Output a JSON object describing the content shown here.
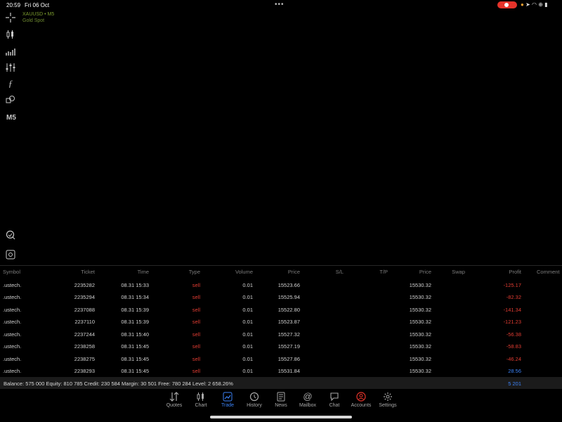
{
  "status_bar": {
    "time": "20:59",
    "date": "Fri 06 Oct"
  },
  "symbol": {
    "name": "XAUUSD",
    "timeframe": "M5",
    "description": "Gold Spot"
  },
  "toolbar": {
    "timeframe_label": "M5"
  },
  "columns": {
    "symbol": "Symbol",
    "ticket": "Ticket",
    "time": "Time",
    "type": "Type",
    "volume": "Volume",
    "price": "Price",
    "sl": "S/L",
    "tp": "T/P",
    "current_price": "Price",
    "swap": "Swap",
    "profit": "Profit",
    "comment": "Comment"
  },
  "rows": [
    {
      "symbol": ".ustech.",
      "ticket": "2235282",
      "time": "08.31 15:33",
      "type": "sell",
      "volume": "0.01",
      "price": "15523.66",
      "current_price": "15530.32",
      "profit": "-125.17"
    },
    {
      "symbol": ".ustech.",
      "ticket": "2235294",
      "time": "08.31 15:34",
      "type": "sell",
      "volume": "0.01",
      "price": "15525.94",
      "current_price": "15530.32",
      "profit": "-82.32"
    },
    {
      "symbol": ".ustech.",
      "ticket": "2237088",
      "time": "08.31 15:39",
      "type": "sell",
      "volume": "0.01",
      "price": "15522.80",
      "current_price": "15530.32",
      "profit": "-141.34"
    },
    {
      "symbol": ".ustech.",
      "ticket": "2237110",
      "time": "08.31 15:39",
      "type": "sell",
      "volume": "0.01",
      "price": "15523.87",
      "current_price": "15530.32",
      "profit": "-121.23"
    },
    {
      "symbol": ".ustech.",
      "ticket": "2237244",
      "time": "08.31 15:40",
      "type": "sell",
      "volume": "0.01",
      "price": "15527.32",
      "current_price": "15530.32",
      "profit": "-56.38"
    },
    {
      "symbol": ".ustech.",
      "ticket": "2238258",
      "time": "08.31 15:45",
      "type": "sell",
      "volume": "0.01",
      "price": "15527.19",
      "current_price": "15530.32",
      "profit": "-58.83"
    },
    {
      "symbol": ".ustech.",
      "ticket": "2238275",
      "time": "08.31 15:45",
      "type": "sell",
      "volume": "0.01",
      "price": "15527.86",
      "current_price": "15530.32",
      "profit": "-46.24"
    },
    {
      "symbol": ".ustech.",
      "ticket": "2238293",
      "time": "08.31 15:45",
      "type": "sell",
      "volume": "0.01",
      "price": "15531.84",
      "current_price": "15530.32",
      "profit": "28.56"
    }
  ],
  "balance": {
    "text": "Balance: 575 000 Equity: 810 785 Credit: 230 584 Margin: 30 501 Free: 780 284 Level: 2 658.26%",
    "profit": "5 201"
  },
  "nav": [
    {
      "label": "Quotes",
      "icon": "quotes-icon"
    },
    {
      "label": "Chart",
      "icon": "candlestick-icon"
    },
    {
      "label": "Trade",
      "icon": "trade-chart-icon",
      "active": true
    },
    {
      "label": "History",
      "icon": "history-icon"
    },
    {
      "label": "News",
      "icon": "news-icon"
    },
    {
      "label": "Mailbox",
      "icon": "at-sign-icon"
    },
    {
      "label": "Chat",
      "icon": "chat-bubble-icon"
    },
    {
      "label": "Accounts",
      "icon": "account-icon"
    },
    {
      "label": "Settings",
      "icon": "gear-icon"
    }
  ],
  "colors": {
    "sell": "#e03c32",
    "loss": "#e03c32",
    "gain": "#3b82f6",
    "active_nav": "#3b82f6",
    "symbol_text": "#7a9a2e",
    "record": "#e5332a"
  }
}
